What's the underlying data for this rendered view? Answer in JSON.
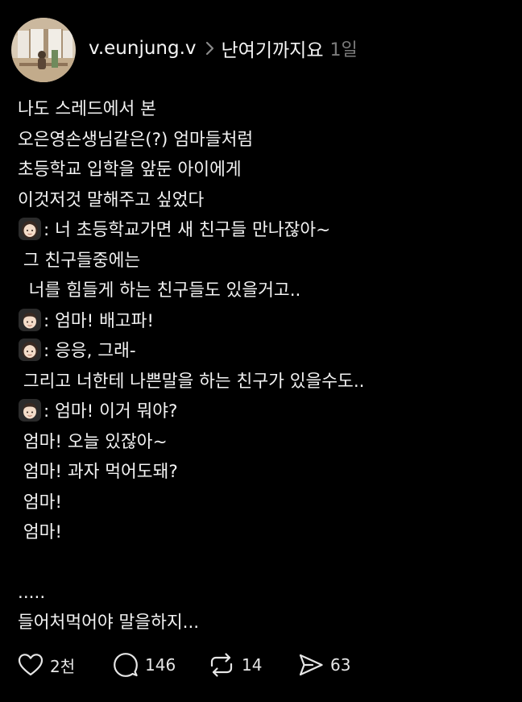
{
  "post_header": {
    "username": "v.eunjung.v",
    "topic": "난여기까지요",
    "time": "1일"
  },
  "post_lines": [
    {
      "text": "나도 스레드에서 본"
    },
    {
      "text": "오은영손생님같은(?) 엄마들처럼"
    },
    {
      "text": "초등학교 입학을 앞둔 아이에게"
    },
    {
      "text": "이것저것 말해주고 싶었다"
    },
    {
      "emoji": "woman-face-emoji",
      "text": ": 너 초등학교가면 새 친구들 만나잖아~"
    },
    {
      "text": " 그 친구들중에는"
    },
    {
      "text": "  너를 힘들게 하는 친구들도 있을거고.."
    },
    {
      "emoji": "boy-face-emoji",
      "text": ": 엄마! 배고파!"
    },
    {
      "emoji": "woman-face-emoji",
      "text": ": 응응, 그래-"
    },
    {
      "text": " 그리고 너한테 나쁜말을 하는 친구가 있을수도.."
    },
    {
      "emoji": "boy-face-emoji",
      "text": ": 엄마! 이거 뭐야?"
    },
    {
      "text": " 엄마! 오늘 있잖아~"
    },
    {
      "text": " 엄마! 과자 먹어도돼?"
    },
    {
      "text": " 엄마!"
    },
    {
      "text": " 엄마!"
    },
    {
      "text": ""
    },
    {
      "text": "....."
    },
    {
      "text": "들어처먹어야 말을하지..."
    }
  ],
  "actions": {
    "likes": {
      "icon": "heart-icon",
      "count": "2천"
    },
    "replies": {
      "icon": "comment-icon",
      "count": "146"
    },
    "reposts": {
      "icon": "repost-icon",
      "count": "14"
    },
    "shares": {
      "icon": "send-icon",
      "count": "63"
    }
  },
  "colors": {
    "background": "#000000",
    "text": "#f3f3f3",
    "muted": "#7b7b7b"
  }
}
